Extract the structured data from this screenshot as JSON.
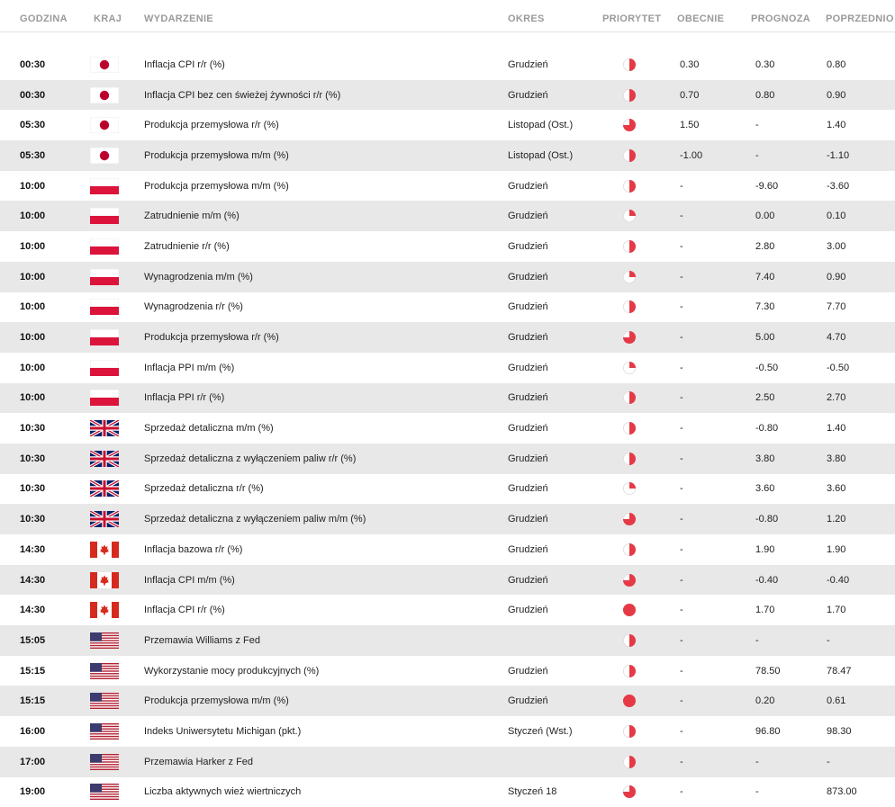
{
  "columns": {
    "time": "GODZINA",
    "country": "KRAJ",
    "event": "WYDARZENIE",
    "period": "OKRES",
    "priority": "PRIORYTET",
    "actual": "OBECNIE",
    "forecast": "PROGNOZA",
    "previous": "POPRZEDNIO"
  },
  "colors": {
    "accent": "#e63946",
    "row_alt": "#e8e8e8"
  },
  "rows": [
    {
      "time": "00:30",
      "country": "JP",
      "event": "Inflacja CPI r/r (%)",
      "period": "Grudzień",
      "priority": 0.5,
      "actual": "0.30",
      "forecast": "0.30",
      "previous": "0.80"
    },
    {
      "time": "00:30",
      "country": "JP",
      "event": "Inflacja CPI bez cen świeżej żywności r/r (%)",
      "period": "Grudzień",
      "priority": 0.5,
      "actual": "0.70",
      "forecast": "0.80",
      "previous": "0.90"
    },
    {
      "time": "05:30",
      "country": "JP",
      "event": "Produkcja przemysłowa r/r (%)",
      "period": "Listopad (Ost.)",
      "priority": 0.75,
      "actual": "1.50",
      "forecast": "-",
      "previous": "1.40"
    },
    {
      "time": "05:30",
      "country": "JP",
      "event": "Produkcja przemysłowa m/m (%)",
      "period": "Listopad (Ost.)",
      "priority": 0.5,
      "actual": "-1.00",
      "forecast": "-",
      "previous": "-1.10"
    },
    {
      "time": "10:00",
      "country": "PL",
      "event": "Produkcja przemysłowa m/m (%)",
      "period": "Grudzień",
      "priority": 0.5,
      "actual": "-",
      "forecast": "-9.60",
      "previous": "-3.60"
    },
    {
      "time": "10:00",
      "country": "PL",
      "event": "Zatrudnienie m/m (%)",
      "period": "Grudzień",
      "priority": 0.25,
      "actual": "-",
      "forecast": "0.00",
      "previous": "0.10"
    },
    {
      "time": "10:00",
      "country": "PL",
      "event": "Zatrudnienie r/r (%)",
      "period": "Grudzień",
      "priority": 0.5,
      "actual": "-",
      "forecast": "2.80",
      "previous": "3.00"
    },
    {
      "time": "10:00",
      "country": "PL",
      "event": "Wynagrodzenia m/m (%)",
      "period": "Grudzień",
      "priority": 0.25,
      "actual": "-",
      "forecast": "7.40",
      "previous": "0.90"
    },
    {
      "time": "10:00",
      "country": "PL",
      "event": "Wynagrodzenia r/r (%)",
      "period": "Grudzień",
      "priority": 0.5,
      "actual": "-",
      "forecast": "7.30",
      "previous": "7.70"
    },
    {
      "time": "10:00",
      "country": "PL",
      "event": "Produkcja przemysłowa r/r (%)",
      "period": "Grudzień",
      "priority": 0.75,
      "actual": "-",
      "forecast": "5.00",
      "previous": "4.70"
    },
    {
      "time": "10:00",
      "country": "PL",
      "event": "Inflacja PPI m/m (%)",
      "period": "Grudzień",
      "priority": 0.25,
      "actual": "-",
      "forecast": "-0.50",
      "previous": "-0.50"
    },
    {
      "time": "10:00",
      "country": "PL",
      "event": "Inflacja PPI r/r (%)",
      "period": "Grudzień",
      "priority": 0.5,
      "actual": "-",
      "forecast": "2.50",
      "previous": "2.70"
    },
    {
      "time": "10:30",
      "country": "GB",
      "event": "Sprzedaż detaliczna m/m (%)",
      "period": "Grudzień",
      "priority": 0.5,
      "actual": "-",
      "forecast": "-0.80",
      "previous": "1.40"
    },
    {
      "time": "10:30",
      "country": "GB",
      "event": "Sprzedaż detaliczna z wyłączeniem paliw r/r (%)",
      "period": "Grudzień",
      "priority": 0.5,
      "actual": "-",
      "forecast": "3.80",
      "previous": "3.80"
    },
    {
      "time": "10:30",
      "country": "GB",
      "event": "Sprzedaż detaliczna r/r (%)",
      "period": "Grudzień",
      "priority": 0.25,
      "actual": "-",
      "forecast": "3.60",
      "previous": "3.60"
    },
    {
      "time": "10:30",
      "country": "GB",
      "event": "Sprzedaż detaliczna z wyłączeniem paliw m/m (%)",
      "period": "Grudzień",
      "priority": 0.75,
      "actual": "-",
      "forecast": "-0.80",
      "previous": "1.20"
    },
    {
      "time": "14:30",
      "country": "CA",
      "event": "Inflacja bazowa r/r (%)",
      "period": "Grudzień",
      "priority": 0.5,
      "actual": "-",
      "forecast": "1.90",
      "previous": "1.90"
    },
    {
      "time": "14:30",
      "country": "CA",
      "event": "Inflacja CPI m/m (%)",
      "period": "Grudzień",
      "priority": 0.75,
      "actual": "-",
      "forecast": "-0.40",
      "previous": "-0.40"
    },
    {
      "time": "14:30",
      "country": "CA",
      "event": "Inflacja CPI r/r (%)",
      "period": "Grudzień",
      "priority": 1,
      "actual": "-",
      "forecast": "1.70",
      "previous": "1.70"
    },
    {
      "time": "15:05",
      "country": "US",
      "event": "Przemawia Williams z Fed",
      "period": "",
      "priority": 0.5,
      "actual": "-",
      "forecast": "-",
      "previous": "-"
    },
    {
      "time": "15:15",
      "country": "US",
      "event": "Wykorzystanie mocy produkcyjnych (%)",
      "period": "Grudzień",
      "priority": 0.5,
      "actual": "-",
      "forecast": "78.50",
      "previous": "78.47"
    },
    {
      "time": "15:15",
      "country": "US",
      "event": "Produkcja przemysłowa m/m (%)",
      "period": "Grudzień",
      "priority": 1,
      "actual": "-",
      "forecast": "0.20",
      "previous": "0.61"
    },
    {
      "time": "16:00",
      "country": "US",
      "event": "Indeks Uniwersytetu Michigan (pkt.)",
      "period": "Styczeń (Wst.)",
      "priority": 0.5,
      "actual": "-",
      "forecast": "96.80",
      "previous": "98.30"
    },
    {
      "time": "17:00",
      "country": "US",
      "event": "Przemawia Harker z Fed",
      "period": "",
      "priority": 0.5,
      "actual": "-",
      "forecast": "-",
      "previous": "-"
    },
    {
      "time": "19:00",
      "country": "US",
      "event": "Liczba aktywnych wież wiertniczych",
      "period": "Styczeń 18",
      "priority": 0.75,
      "actual": "-",
      "forecast": "-",
      "previous": "873.00"
    }
  ]
}
